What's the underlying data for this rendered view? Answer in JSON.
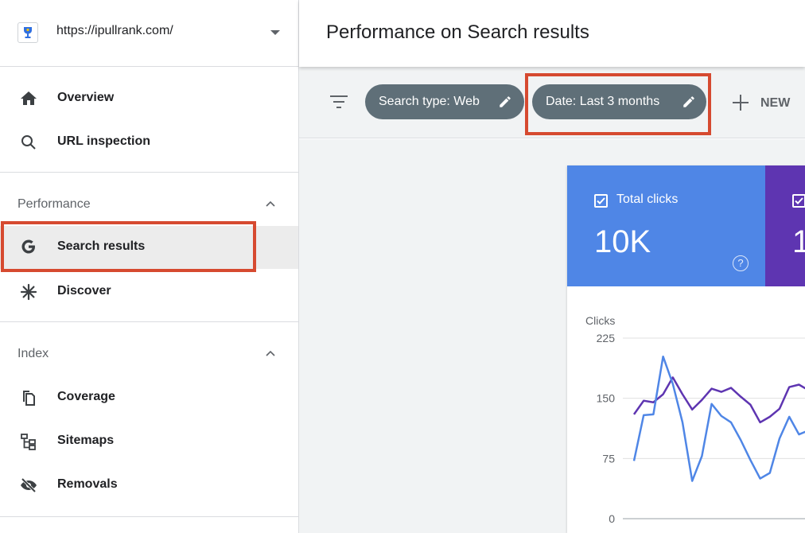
{
  "property": {
    "url": "https://ipullrank.com/"
  },
  "nav": {
    "overview": "Overview",
    "url_inspection": "URL inspection",
    "performance_section": "Performance",
    "search_results": "Search results",
    "discover": "Discover",
    "index_section": "Index",
    "coverage": "Coverage",
    "sitemaps": "Sitemaps",
    "removals": "Removals"
  },
  "header": {
    "title": "Performance on Search results"
  },
  "filters": {
    "search_type": "Search type: Web",
    "date": "Date: Last 3 months",
    "new": "NEW"
  },
  "metrics": {
    "total_clicks_label": "Total clicks",
    "total_clicks_value": "10K",
    "help": "?",
    "impressions_value_partial": "1"
  },
  "colors": {
    "clicks": "#4f86e6",
    "impressions": "#5e35b1",
    "highlight": "#d64a30",
    "chip": "#5f6f78"
  },
  "chart_data": {
    "type": "line",
    "ylabel": "Clicks",
    "yticks": [
      0,
      75,
      150,
      225
    ],
    "ylim": [
      0,
      225
    ],
    "x": [
      1,
      2,
      3,
      4,
      5,
      6,
      7,
      8,
      9,
      10,
      11,
      12,
      13,
      14,
      15,
      16,
      17,
      18,
      19,
      20,
      21,
      22
    ],
    "series": [
      {
        "color": "#4f86e6",
        "values": [
          72,
          129,
          130,
          202,
          168,
          120,
          47,
          78,
          143,
          128,
          120,
          98,
          73,
          50,
          57,
          100,
          127,
          105,
          110
        ]
      },
      {
        "color": "#5e35b1",
        "values": [
          130,
          147,
          145,
          155,
          176,
          155,
          136,
          148,
          162,
          158,
          163,
          152,
          142,
          120,
          127,
          137,
          164,
          167,
          160
        ]
      }
    ]
  }
}
